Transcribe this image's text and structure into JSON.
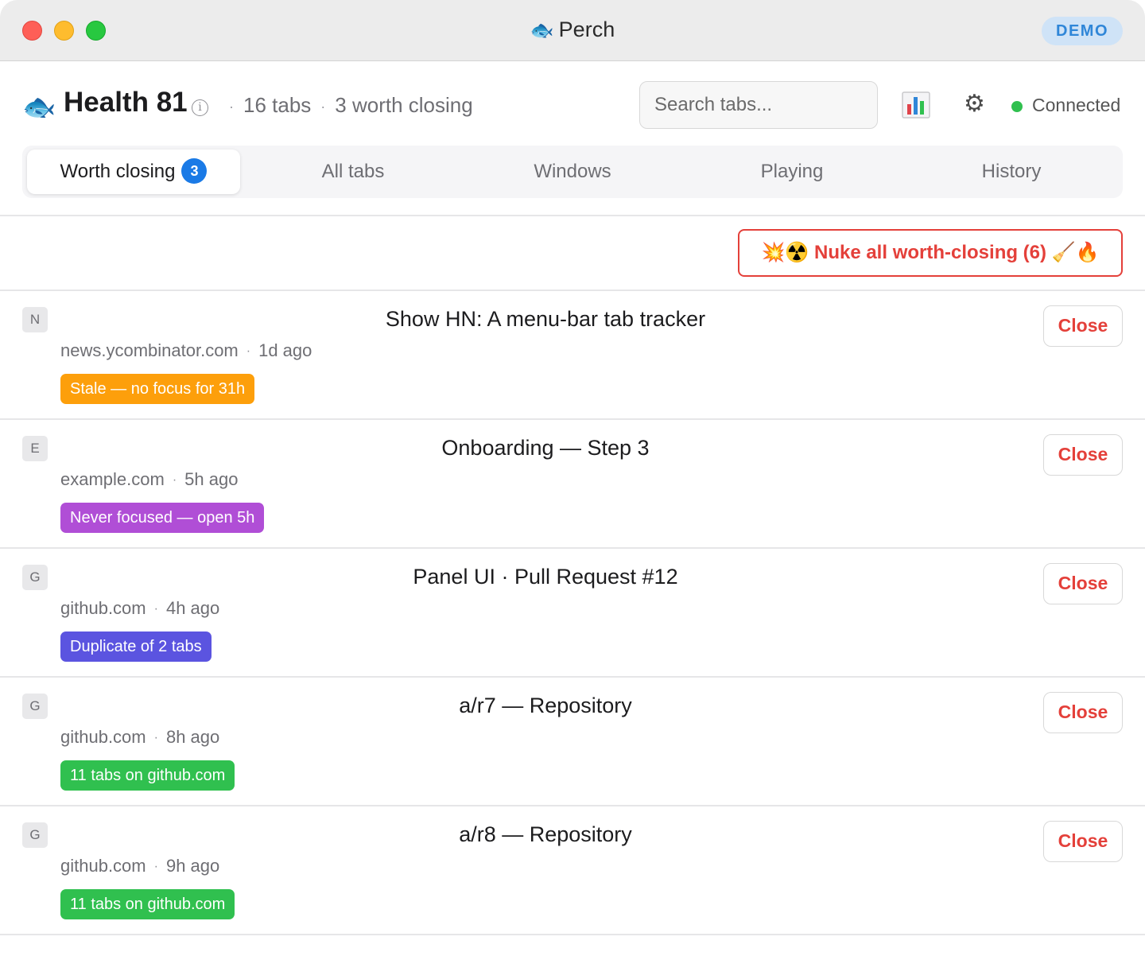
{
  "window": {
    "app_icon": "fish-icon",
    "title": "Perch",
    "badge": "DEMO"
  },
  "header": {
    "health": "Health 81",
    "info_glyph": "i",
    "tab_count": "16 tabs",
    "worth_closing": "3 worth closing",
    "search_placeholder": "Search tabs...",
    "stats_icon": "bar-chart-icon",
    "settings_icon": "gear-icon",
    "connection_status": "Connected",
    "connection_color": "#30c04f"
  },
  "tabs": [
    {
      "label": "Worth closing",
      "count": "3",
      "active": true
    },
    {
      "label": "All tabs"
    },
    {
      "label": "Windows"
    },
    {
      "label": "Playing"
    },
    {
      "label": "History"
    }
  ],
  "nuke_button": "💥☢️ Nuke all worth-closing (6) 🧹🔥",
  "rows": [
    {
      "favicon": "N",
      "title": "Show HN: A menu-bar tab tracker",
      "domain": "news.ycombinator.com",
      "age": "1d ago",
      "badge": "Stale — no focus for 31h",
      "badge_color": "#fd9f0b",
      "close": "Close"
    },
    {
      "favicon": "E",
      "title": "Onboarding — Step 3",
      "domain": "example.com",
      "age": "5h ago",
      "badge": "Never focused — open 5h",
      "badge_color": "#b04ed6",
      "close": "Close"
    },
    {
      "favicon": "G",
      "title": "Panel UI · Pull Request #12",
      "domain": "github.com",
      "age": "4h ago",
      "badge": "Duplicate of 2 tabs",
      "badge_color": "#5b54e0",
      "close": "Close"
    },
    {
      "favicon": "G",
      "title": "a/r7 — Repository",
      "domain": "github.com",
      "age": "8h ago",
      "badge": "11 tabs on github.com",
      "badge_color": "#30c04f",
      "close": "Close"
    },
    {
      "favicon": "G",
      "title": "a/r8 — Repository",
      "domain": "github.com",
      "age": "9h ago",
      "badge": "11 tabs on github.com",
      "badge_color": "#30c04f",
      "close": "Close"
    }
  ]
}
